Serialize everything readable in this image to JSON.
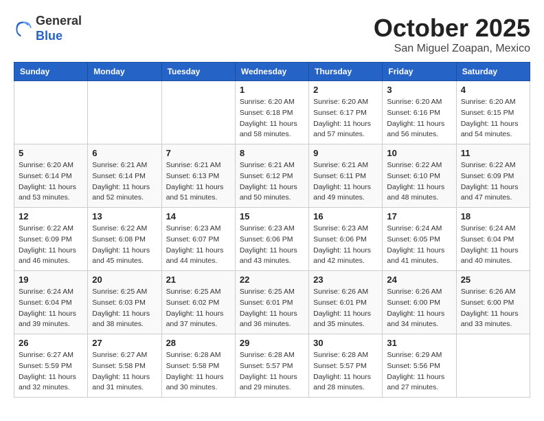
{
  "header": {
    "logo_general": "General",
    "logo_blue": "Blue",
    "month": "October 2025",
    "location": "San Miguel Zoapan, Mexico"
  },
  "weekdays": [
    "Sunday",
    "Monday",
    "Tuesday",
    "Wednesday",
    "Thursday",
    "Friday",
    "Saturday"
  ],
  "weeks": [
    [
      {
        "day": "",
        "sunrise": "",
        "sunset": "",
        "daylight": ""
      },
      {
        "day": "",
        "sunrise": "",
        "sunset": "",
        "daylight": ""
      },
      {
        "day": "",
        "sunrise": "",
        "sunset": "",
        "daylight": ""
      },
      {
        "day": "1",
        "sunrise": "Sunrise: 6:20 AM",
        "sunset": "Sunset: 6:18 PM",
        "daylight": "Daylight: 11 hours and 58 minutes."
      },
      {
        "day": "2",
        "sunrise": "Sunrise: 6:20 AM",
        "sunset": "Sunset: 6:17 PM",
        "daylight": "Daylight: 11 hours and 57 minutes."
      },
      {
        "day": "3",
        "sunrise": "Sunrise: 6:20 AM",
        "sunset": "Sunset: 6:16 PM",
        "daylight": "Daylight: 11 hours and 56 minutes."
      },
      {
        "day": "4",
        "sunrise": "Sunrise: 6:20 AM",
        "sunset": "Sunset: 6:15 PM",
        "daylight": "Daylight: 11 hours and 54 minutes."
      }
    ],
    [
      {
        "day": "5",
        "sunrise": "Sunrise: 6:20 AM",
        "sunset": "Sunset: 6:14 PM",
        "daylight": "Daylight: 11 hours and 53 minutes."
      },
      {
        "day": "6",
        "sunrise": "Sunrise: 6:21 AM",
        "sunset": "Sunset: 6:14 PM",
        "daylight": "Daylight: 11 hours and 52 minutes."
      },
      {
        "day": "7",
        "sunrise": "Sunrise: 6:21 AM",
        "sunset": "Sunset: 6:13 PM",
        "daylight": "Daylight: 11 hours and 51 minutes."
      },
      {
        "day": "8",
        "sunrise": "Sunrise: 6:21 AM",
        "sunset": "Sunset: 6:12 PM",
        "daylight": "Daylight: 11 hours and 50 minutes."
      },
      {
        "day": "9",
        "sunrise": "Sunrise: 6:21 AM",
        "sunset": "Sunset: 6:11 PM",
        "daylight": "Daylight: 11 hours and 49 minutes."
      },
      {
        "day": "10",
        "sunrise": "Sunrise: 6:22 AM",
        "sunset": "Sunset: 6:10 PM",
        "daylight": "Daylight: 11 hours and 48 minutes."
      },
      {
        "day": "11",
        "sunrise": "Sunrise: 6:22 AM",
        "sunset": "Sunset: 6:09 PM",
        "daylight": "Daylight: 11 hours and 47 minutes."
      }
    ],
    [
      {
        "day": "12",
        "sunrise": "Sunrise: 6:22 AM",
        "sunset": "Sunset: 6:09 PM",
        "daylight": "Daylight: 11 hours and 46 minutes."
      },
      {
        "day": "13",
        "sunrise": "Sunrise: 6:22 AM",
        "sunset": "Sunset: 6:08 PM",
        "daylight": "Daylight: 11 hours and 45 minutes."
      },
      {
        "day": "14",
        "sunrise": "Sunrise: 6:23 AM",
        "sunset": "Sunset: 6:07 PM",
        "daylight": "Daylight: 11 hours and 44 minutes."
      },
      {
        "day": "15",
        "sunrise": "Sunrise: 6:23 AM",
        "sunset": "Sunset: 6:06 PM",
        "daylight": "Daylight: 11 hours and 43 minutes."
      },
      {
        "day": "16",
        "sunrise": "Sunrise: 6:23 AM",
        "sunset": "Sunset: 6:06 PM",
        "daylight": "Daylight: 11 hours and 42 minutes."
      },
      {
        "day": "17",
        "sunrise": "Sunrise: 6:24 AM",
        "sunset": "Sunset: 6:05 PM",
        "daylight": "Daylight: 11 hours and 41 minutes."
      },
      {
        "day": "18",
        "sunrise": "Sunrise: 6:24 AM",
        "sunset": "Sunset: 6:04 PM",
        "daylight": "Daylight: 11 hours and 40 minutes."
      }
    ],
    [
      {
        "day": "19",
        "sunrise": "Sunrise: 6:24 AM",
        "sunset": "Sunset: 6:04 PM",
        "daylight": "Daylight: 11 hours and 39 minutes."
      },
      {
        "day": "20",
        "sunrise": "Sunrise: 6:25 AM",
        "sunset": "Sunset: 6:03 PM",
        "daylight": "Daylight: 11 hours and 38 minutes."
      },
      {
        "day": "21",
        "sunrise": "Sunrise: 6:25 AM",
        "sunset": "Sunset: 6:02 PM",
        "daylight": "Daylight: 11 hours and 37 minutes."
      },
      {
        "day": "22",
        "sunrise": "Sunrise: 6:25 AM",
        "sunset": "Sunset: 6:01 PM",
        "daylight": "Daylight: 11 hours and 36 minutes."
      },
      {
        "day": "23",
        "sunrise": "Sunrise: 6:26 AM",
        "sunset": "Sunset: 6:01 PM",
        "daylight": "Daylight: 11 hours and 35 minutes."
      },
      {
        "day": "24",
        "sunrise": "Sunrise: 6:26 AM",
        "sunset": "Sunset: 6:00 PM",
        "daylight": "Daylight: 11 hours and 34 minutes."
      },
      {
        "day": "25",
        "sunrise": "Sunrise: 6:26 AM",
        "sunset": "Sunset: 6:00 PM",
        "daylight": "Daylight: 11 hours and 33 minutes."
      }
    ],
    [
      {
        "day": "26",
        "sunrise": "Sunrise: 6:27 AM",
        "sunset": "Sunset: 5:59 PM",
        "daylight": "Daylight: 11 hours and 32 minutes."
      },
      {
        "day": "27",
        "sunrise": "Sunrise: 6:27 AM",
        "sunset": "Sunset: 5:58 PM",
        "daylight": "Daylight: 11 hours and 31 minutes."
      },
      {
        "day": "28",
        "sunrise": "Sunrise: 6:28 AM",
        "sunset": "Sunset: 5:58 PM",
        "daylight": "Daylight: 11 hours and 30 minutes."
      },
      {
        "day": "29",
        "sunrise": "Sunrise: 6:28 AM",
        "sunset": "Sunset: 5:57 PM",
        "daylight": "Daylight: 11 hours and 29 minutes."
      },
      {
        "day": "30",
        "sunrise": "Sunrise: 6:28 AM",
        "sunset": "Sunset: 5:57 PM",
        "daylight": "Daylight: 11 hours and 28 minutes."
      },
      {
        "day": "31",
        "sunrise": "Sunrise: 6:29 AM",
        "sunset": "Sunset: 5:56 PM",
        "daylight": "Daylight: 11 hours and 27 minutes."
      },
      {
        "day": "",
        "sunrise": "",
        "sunset": "",
        "daylight": ""
      }
    ]
  ]
}
